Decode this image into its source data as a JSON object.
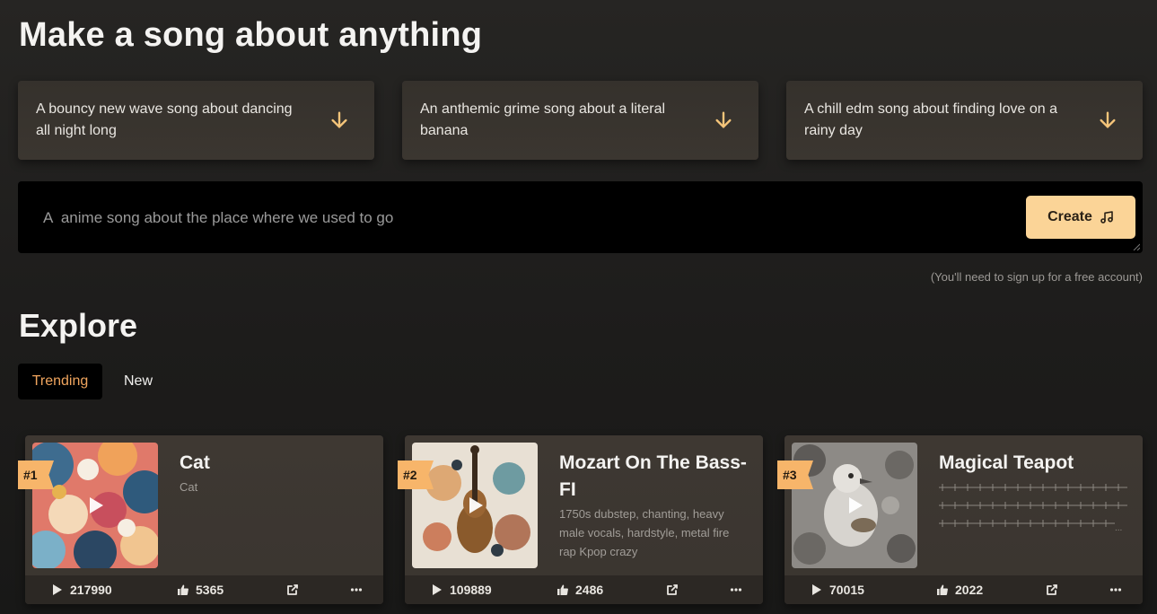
{
  "header": {
    "title": "Make a song about anything"
  },
  "suggestions": [
    {
      "text": "A bouncy new wave song about dancing all night long",
      "icon": "arrow-down-icon"
    },
    {
      "text": "An anthemic grime song about a literal banana",
      "icon": "arrow-down-icon"
    },
    {
      "text": "A chill edm song about finding love on a rainy day",
      "icon": "arrow-down-icon"
    }
  ],
  "prompt": {
    "placeholder": "A  anime song about the place where we used to go",
    "create_label": "Create",
    "create_icon": "music-note-icon",
    "signup_note": "(You'll need to sign up for a free account)"
  },
  "explore": {
    "title": "Explore",
    "tabs": [
      {
        "label": "Trending",
        "active": true
      },
      {
        "label": "New",
        "active": false
      }
    ]
  },
  "songs": [
    {
      "rank": "#1",
      "title": "Cat",
      "description": "Cat",
      "plays": "217990",
      "likes": "5365"
    },
    {
      "rank": "#2",
      "title": "Mozart On The Bass-FI",
      "description": "1750s dubstep, chanting, heavy male vocals, hardstyle, metal fire rap Kpop crazy",
      "plays": "109889",
      "likes": "2486"
    },
    {
      "rank": "#3",
      "title": "Magical Teapot",
      "description": "",
      "plays": "70015",
      "likes": "2022"
    }
  ],
  "colors": {
    "accent": "#fbd497",
    "rank_badge": "#f7b56a",
    "active_tab_text": "#f0a55e",
    "card_bg": "#3e3832"
  }
}
